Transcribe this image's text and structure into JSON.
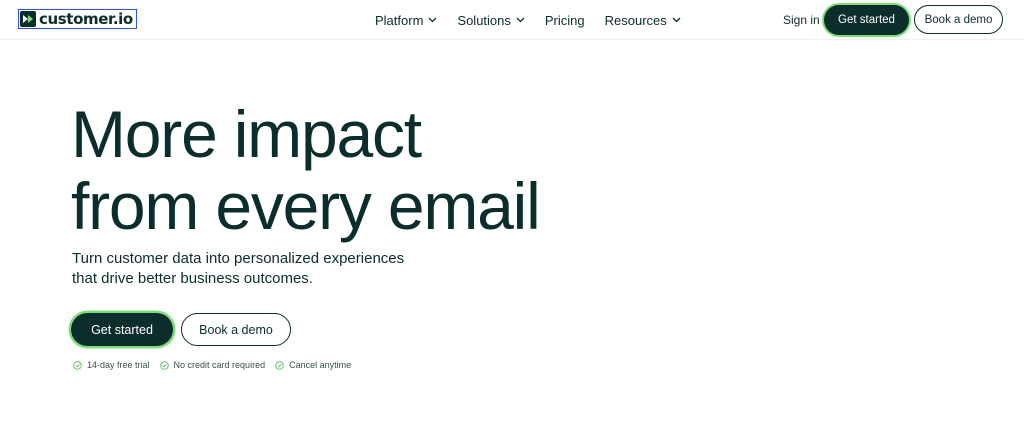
{
  "brand": {
    "name": "customer.io",
    "logo_icon": "customerio-logo-icon",
    "accent_color": "#7ddc7a",
    "primary_color": "#0b2d2b"
  },
  "nav": {
    "items": [
      {
        "label": "Platform",
        "has_dropdown": true
      },
      {
        "label": "Solutions",
        "has_dropdown": true
      },
      {
        "label": "Pricing",
        "has_dropdown": false
      },
      {
        "label": "Resources",
        "has_dropdown": true
      }
    ],
    "sign_in": "Sign in",
    "get_started": "Get started",
    "book_demo": "Book a demo"
  },
  "hero": {
    "title_line1": "More impact",
    "title_line2": "from every email",
    "subtitle": "Turn customer data into personalized experiences that drive better business outcomes.",
    "primary_cta": "Get started",
    "secondary_cta": "Book a demo",
    "perks": [
      "14-day free trial",
      "No credit card required",
      "Cancel anytime"
    ],
    "perk_icon": "check-circle-icon"
  }
}
